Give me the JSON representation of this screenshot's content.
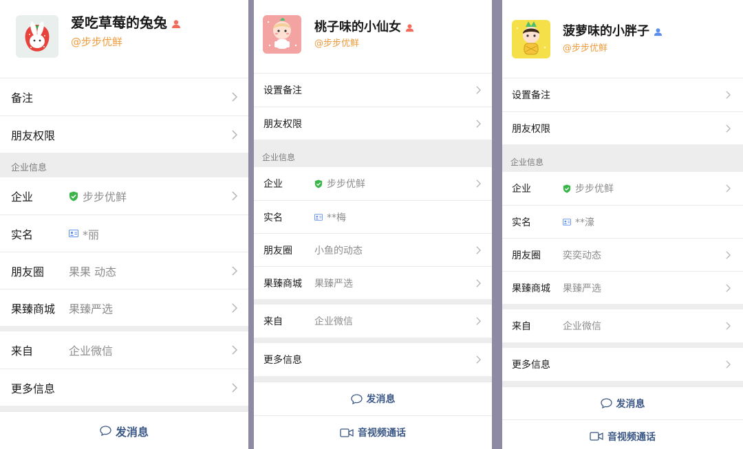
{
  "panels": [
    {
      "name": "爱吃草莓的兔兔",
      "company": "@步步优鲜",
      "remark_label": "备注",
      "permission_label": "朋友权限",
      "section_label": "企业信息",
      "enterprise_key": "企业",
      "enterprise_value": "步步优鲜",
      "realname_key": "实名",
      "realname_value": "*丽",
      "moments_key": "朋友圈",
      "moments_value": "果果 动态",
      "mall_key": "果臻商城",
      "mall_value": "果臻严选",
      "from_key": "来自",
      "from_value": "企业微信",
      "more_label": "更多信息",
      "send_label": "发消息",
      "gender_color": "#f26b5b"
    },
    {
      "name": "桃子味的小仙女",
      "company": "@步步优鲜",
      "remark_label": "设置备注",
      "permission_label": "朋友权限",
      "section_label": "企业信息",
      "enterprise_key": "企业",
      "enterprise_value": "步步优鲜",
      "realname_key": "实名",
      "realname_value": "**梅",
      "moments_key": "朋友圈",
      "moments_value": "小鱼的动态",
      "mall_key": "果臻商城",
      "mall_value": "果臻严选",
      "from_key": "来自",
      "from_value": "企业微信",
      "more_label": "更多信息",
      "send_label": "发消息",
      "call_label": "音视频通话",
      "gender_color": "#f26b5b"
    },
    {
      "name": "菠萝味的小胖子",
      "company": "@步步优鲜",
      "remark_label": "设置备注",
      "permission_label": "朋友权限",
      "section_label": "企业信息",
      "enterprise_key": "企业",
      "enterprise_value": "步步优鲜",
      "realname_key": "实名",
      "realname_value": "**濠",
      "moments_key": "朋友圈",
      "moments_value": "奕奕动态",
      "mall_key": "果臻商城",
      "mall_value": "果臻严选",
      "from_key": "来自",
      "from_value": "企业微信",
      "more_label": "更多信息",
      "send_label": "发消息",
      "call_label": "音视频通话",
      "gender_color": "#5b8def"
    }
  ],
  "colors": {
    "company_orange": "#f09b3b",
    "verified_green": "#3bb54a",
    "action_blue": "#3b5785",
    "divider_purple": "#8e8aa3"
  },
  "icons": {
    "gender_female": "person-icon",
    "gender_male": "person-icon",
    "verified": "shield-check-icon",
    "id_card": "id-card-icon",
    "chevron": "chevron-right-icon",
    "message": "chat-bubble-icon",
    "video": "video-camera-icon"
  }
}
